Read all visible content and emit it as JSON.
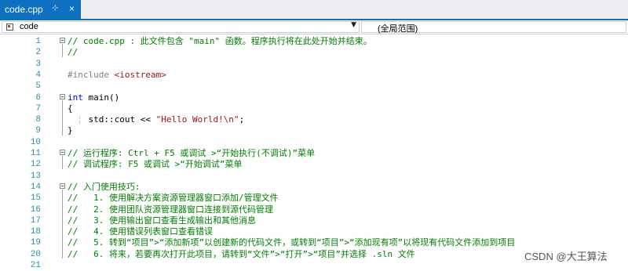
{
  "tab": {
    "title": "code.cpp",
    "pin_glyph": "⊹",
    "close_glyph": "×"
  },
  "nav": {
    "scope": "code",
    "global": "(全局范围)"
  },
  "lines": [
    {
      "n": "1",
      "parts": [
        [
          "cmt",
          "// code.cpp : 此文件包含 \"main\" 函数。程序执行将在此处开始并结束。"
        ]
      ]
    },
    {
      "n": "2",
      "parts": [
        [
          "cmt",
          "//"
        ]
      ]
    },
    {
      "n": "3",
      "parts": []
    },
    {
      "n": "4",
      "parts": [
        [
          "pp",
          "#include "
        ],
        [
          "str",
          "<iostream>"
        ]
      ]
    },
    {
      "n": "5",
      "parts": []
    },
    {
      "n": "6",
      "parts": [
        [
          "kw",
          "int"
        ],
        [
          "plain",
          " main()"
        ]
      ]
    },
    {
      "n": "7",
      "parts": [
        [
          "plain",
          "{"
        ]
      ]
    },
    {
      "n": "8",
      "parts": [
        [
          "plain",
          "    std::cout << "
        ],
        [
          "str",
          "\"Hello World!\\n\""
        ],
        [
          "plain",
          ";"
        ]
      ]
    },
    {
      "n": "9",
      "parts": [
        [
          "plain",
          "}"
        ]
      ]
    },
    {
      "n": "10",
      "parts": []
    },
    {
      "n": "11",
      "parts": [
        [
          "cmt",
          "// 运行程序: Ctrl + F5 或调试 >“开始执行(不调试)”菜单"
        ]
      ]
    },
    {
      "n": "12",
      "parts": [
        [
          "cmt",
          "// 调试程序: F5 或调试 >“开始调试”菜单"
        ]
      ]
    },
    {
      "n": "13",
      "parts": []
    },
    {
      "n": "14",
      "parts": [
        [
          "cmt",
          "// 入门使用技巧:"
        ]
      ]
    },
    {
      "n": "15",
      "parts": [
        [
          "cmt",
          "//   1. 使用解决方案资源管理器窗口添加/管理文件"
        ]
      ]
    },
    {
      "n": "16",
      "parts": [
        [
          "cmt",
          "//   2. 使用团队资源管理器窗口连接到源代码管理"
        ]
      ]
    },
    {
      "n": "17",
      "parts": [
        [
          "cmt",
          "//   3. 使用输出窗口查看生成输出和其他消息"
        ]
      ]
    },
    {
      "n": "18",
      "parts": [
        [
          "cmt",
          "//   4. 使用错误列表窗口查看错误"
        ]
      ]
    },
    {
      "n": "19",
      "parts": [
        [
          "cmt",
          "//   5. 转到“项目”>“添加新项”以创建新的代码文件，或转到“项目”>“添加现有项”以将现有代码文件添加到项目"
        ]
      ]
    },
    {
      "n": "20",
      "parts": [
        [
          "cmt",
          "//   6. 将来，若要再次打开此项目，请转到“文件”>“打开”>“项目”并选择 .sln 文件"
        ]
      ]
    },
    {
      "n": "21",
      "parts": []
    }
  ],
  "watermark": "CSDN @大王算法",
  "colors": {
    "accent": "#0e70c0",
    "line_number": "#2b91af",
    "comment": "#008000",
    "keyword": "#0000ff",
    "string": "#a31515",
    "preprocessor": "#808080"
  }
}
